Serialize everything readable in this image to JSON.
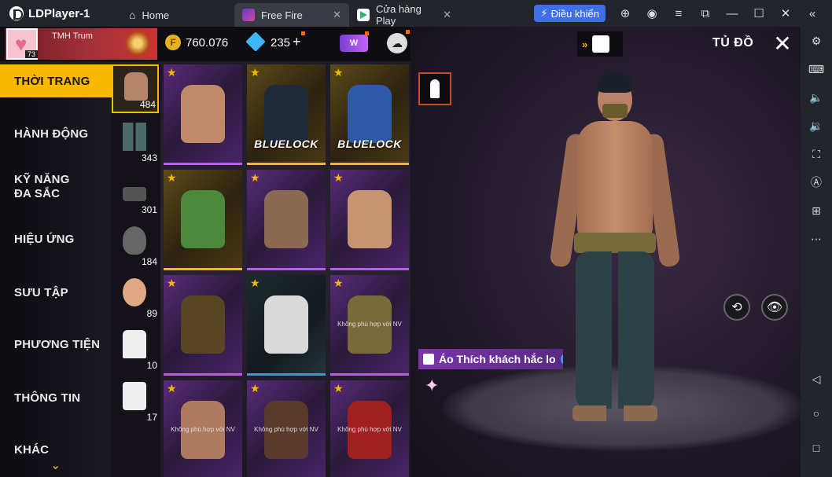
{
  "app": {
    "title": "LDPlayer-1",
    "tabs": [
      {
        "label": "Home"
      },
      {
        "label": "Free Fire"
      },
      {
        "label": "Cửa hàng Play"
      }
    ],
    "control_button": "Điều khiển"
  },
  "player": {
    "level": "73",
    "name": "TMH",
    "tag": "Trum"
  },
  "currency": {
    "gold": "760.076",
    "diamonds": "235",
    "plus": "+"
  },
  "nav": {
    "items": [
      {
        "label": "THỜI TRANG",
        "active": true
      },
      {
        "label": "HÀNH ĐỘNG"
      },
      {
        "label": "KỸ NĂNG ĐA SẮC"
      },
      {
        "label": "HIỆU ỨNG"
      },
      {
        "label": "SƯU TẬP"
      },
      {
        "label": "PHƯƠNG TIỆN"
      },
      {
        "label": "THÔNG TIN"
      },
      {
        "label": "KHÁC"
      }
    ]
  },
  "categories": [
    {
      "count": "484",
      "icon": "top-icon"
    },
    {
      "count": "343",
      "icon": "pants-icon"
    },
    {
      "count": "301",
      "icon": "shoes-icon"
    },
    {
      "count": "184",
      "icon": "mask-icon"
    },
    {
      "count": "89",
      "icon": "head-icon"
    },
    {
      "count": "10",
      "icon": "outfit-icon"
    },
    {
      "count": "17",
      "icon": "info-icon"
    }
  ],
  "items": [
    {
      "style": "purple",
      "label": "",
      "note": ""
    },
    {
      "style": "gold",
      "label": "BLUELOCK",
      "note": ""
    },
    {
      "style": "gold",
      "label": "BLUELOCK",
      "note": ""
    },
    {
      "style": "gold",
      "label": "",
      "note": ""
    },
    {
      "style": "purple",
      "label": "",
      "note": ""
    },
    {
      "style": "purple",
      "label": "",
      "note": ""
    },
    {
      "style": "purple",
      "label": "",
      "note": ""
    },
    {
      "style": "dark",
      "label": "",
      "note": ""
    },
    {
      "style": "purple",
      "label": "",
      "note": "Không phù hợp với NV"
    },
    {
      "style": "purple",
      "label": "",
      "note": "Không phù hợp với NV"
    },
    {
      "style": "purple",
      "label": "",
      "note": "Không phù hợp với NV"
    },
    {
      "style": "purple",
      "label": "",
      "note": "Không phù hợp với NV"
    }
  ],
  "scene": {
    "title": "TỦ ĐỒ",
    "selected_item": "Áo Thích khách hắc lo"
  },
  "colors": {
    "accent": "#f7b900",
    "titlebar": "#23252d",
    "control_button": "#3f6fe6"
  }
}
